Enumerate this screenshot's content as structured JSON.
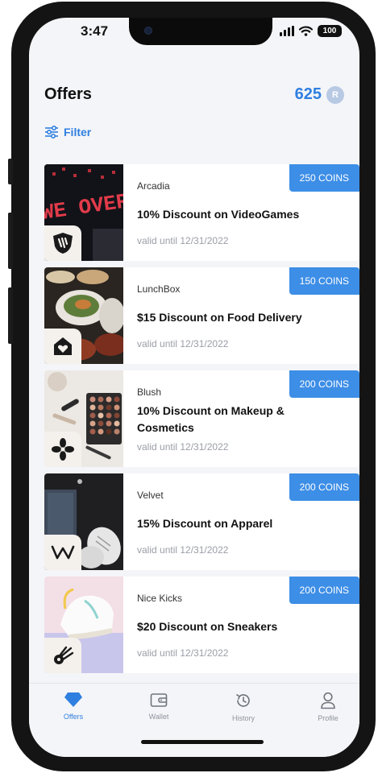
{
  "status_bar": {
    "time": "3:47",
    "battery": "100"
  },
  "header": {
    "title": "Offers",
    "coins": "625",
    "coin_symbol": "R"
  },
  "filter": {
    "label": "Filter"
  },
  "offers": [
    {
      "brand": "Arcadia",
      "title": "10% Discount on VideoGames",
      "valid": "valid until 12/31/2022",
      "coins": "250 COINS",
      "logo": "shield-claw-icon"
    },
    {
      "brand": "LunchBox",
      "title": "$15 Discount on Food Delivery",
      "valid": "valid until 12/31/2022",
      "coins": "150 COINS",
      "logo": "house-heart-icon"
    },
    {
      "brand": "Blush",
      "title": "10% Discount on Makeup & Cosmetics",
      "valid": "valid until 12/31/2022",
      "coins": "200 COINS",
      "logo": "flower-icon"
    },
    {
      "brand": "Velvet",
      "title": "15% Discount on Apparel",
      "valid": "valid until 12/31/2022",
      "coins": "200 COINS",
      "logo": "w-logo-icon"
    },
    {
      "brand": "Nice Kicks",
      "title": "$20 Discount on Sneakers",
      "valid": "valid until 12/31/2022",
      "coins": "200 COINS",
      "logo": "comet-icon"
    }
  ],
  "tabs": [
    {
      "label": "Offers",
      "icon": "diamond-icon",
      "active": true
    },
    {
      "label": "Wallet",
      "icon": "wallet-icon",
      "active": false
    },
    {
      "label": "History",
      "icon": "history-icon",
      "active": false
    },
    {
      "label": "Profile",
      "icon": "profile-icon",
      "active": false
    }
  ],
  "colors": {
    "accent": "#2f7fe0",
    "badge": "#3d8ee6",
    "background": "#f4f5f8"
  }
}
